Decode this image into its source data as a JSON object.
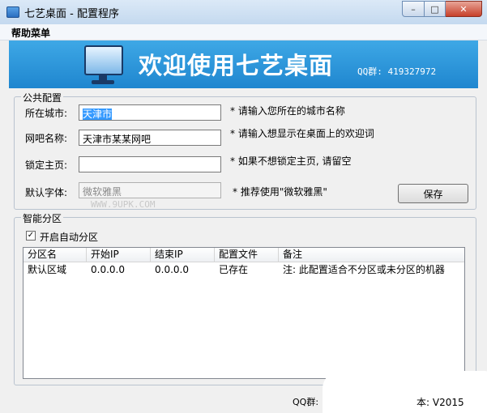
{
  "window": {
    "title": "七艺桌面 - 配置程序"
  },
  "menu": {
    "help": "帮助菜单"
  },
  "banner": {
    "title": "欢迎使用七艺桌面",
    "qq": "QQ群: 419327972"
  },
  "public_config": {
    "legend": "公共配置",
    "city_label": "所在城市:",
    "city_value": "天津市",
    "city_hint": "* 请输入您所在的城市名称",
    "netbar_label": "网吧名称:",
    "netbar_value": "天津市某某网吧",
    "netbar_hint": "* 请输入想显示在桌面上的欢迎词",
    "homepage_label": "锁定主页:",
    "homepage_value": "",
    "homepage_hint": "* 如果不想锁定主页, 请留空",
    "font_label": "默认字体:",
    "font_value": "微软雅黑",
    "font_hint": "* 推荐使用\"微软雅黑\"",
    "save_label": "保存",
    "watermark": "WWW.9UPK.COM"
  },
  "smart_partition": {
    "legend": "智能分区",
    "auto_label": "开启自动分区",
    "auto_checked": true,
    "columns": [
      "分区名",
      "开始IP",
      "结束IP",
      "配置文件",
      "备注"
    ],
    "rows": [
      [
        "默认区域",
        "0.0.0.0",
        "0.0.0.0",
        "已存在",
        "注: 此配置适合不分区或未分区的机器"
      ]
    ]
  },
  "status": {
    "qq_label": "QQ群:",
    "version": "本: V2015"
  }
}
